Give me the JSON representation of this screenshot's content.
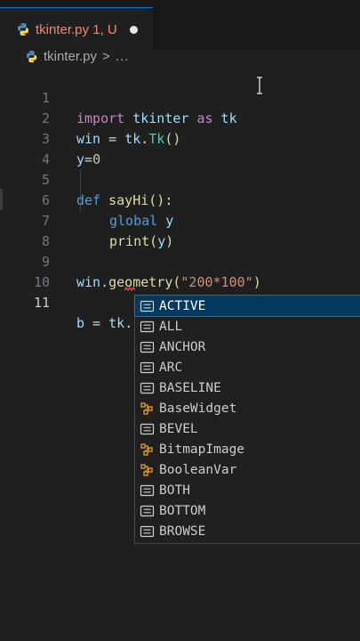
{
  "tab": {
    "label": "tkinter.py 1, U"
  },
  "breadcrumb": {
    "file": "tkinter.py",
    "separator": ">",
    "more": "..."
  },
  "editor": {
    "lines": [
      {
        "num": "1",
        "tokens": [
          "import",
          " tkinter ",
          "as",
          " tk"
        ]
      },
      {
        "num": "2",
        "tokens": [
          "win",
          " = ",
          "tk",
          ".",
          "Tk",
          "()"
        ]
      },
      {
        "num": "3",
        "tokens": [
          "y",
          "=",
          "0"
        ]
      },
      {
        "num": "4",
        "tokens": []
      },
      {
        "num": "5",
        "tokens": [
          "def",
          " ",
          "sayHi",
          "():"
        ]
      },
      {
        "num": "6",
        "tokens": [
          "global",
          " ",
          "y"
        ]
      },
      {
        "num": "7",
        "tokens": [
          "print",
          "(",
          "y",
          ")"
        ]
      },
      {
        "num": "8",
        "tokens": []
      },
      {
        "num": "9",
        "tokens": [
          "win",
          ".",
          "geometry",
          "(",
          "\"200*100\"",
          ")"
        ]
      },
      {
        "num": "10",
        "tokens": []
      },
      {
        "num": "11",
        "tokens": [
          "b",
          " = ",
          "tk",
          "."
        ]
      }
    ]
  },
  "suggestions": {
    "items": [
      {
        "label": "ACTIVE",
        "kind": "constant-icon",
        "selected": true
      },
      {
        "label": "ALL",
        "kind": "constant-icon"
      },
      {
        "label": "ANCHOR",
        "kind": "constant-icon"
      },
      {
        "label": "ARC",
        "kind": "constant-icon"
      },
      {
        "label": "BASELINE",
        "kind": "constant-icon"
      },
      {
        "label": "BaseWidget",
        "kind": "class-icon"
      },
      {
        "label": "BEVEL",
        "kind": "constant-icon"
      },
      {
        "label": "BitmapImage",
        "kind": "class-icon"
      },
      {
        "label": "BooleanVar",
        "kind": "class-icon"
      },
      {
        "label": "BOTH",
        "kind": "constant-icon"
      },
      {
        "label": "BOTTOM",
        "kind": "constant-icon"
      },
      {
        "label": "BROWSE",
        "kind": "constant-icon"
      }
    ]
  },
  "colors": {
    "keyword": "#c586c0",
    "storage": "#569cd6",
    "variable": "#9cdcfe",
    "function": "#dcdcaa",
    "number": "#b5cea8",
    "string": "#ce9178",
    "tab_modified": "#f48771",
    "selection": "#04395e",
    "focus_border": "#0078d4",
    "class_icon": "#ee9d28"
  }
}
